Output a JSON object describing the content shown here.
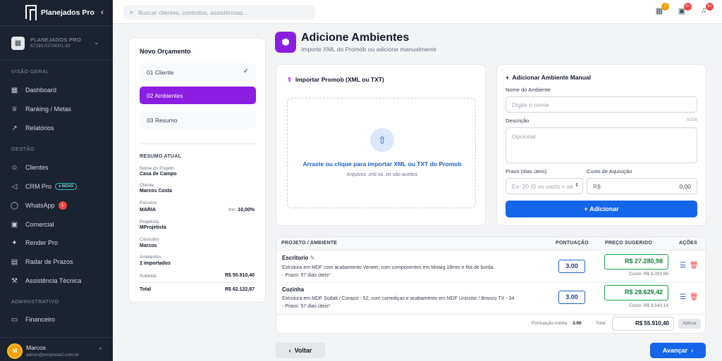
{
  "app": {
    "name": "Planejados Pro"
  },
  "company": {
    "name": "PLANEJADOS PRO",
    "cnpj": "87195.037/0001-10"
  },
  "sidebar": {
    "sections": {
      "overview": "VISÃO GERAL",
      "management": "GESTÃO",
      "admin": "ADMINISTRATIVO"
    },
    "items": [
      {
        "label": "Dashboard"
      },
      {
        "label": "Ranking / Metas"
      },
      {
        "label": "Relatórios"
      },
      {
        "label": "Clientes"
      },
      {
        "label": "CRM Pro",
        "badge": "● NOVO"
      },
      {
        "label": "WhatsApp",
        "badge": "1"
      },
      {
        "label": "Comercial"
      },
      {
        "label": "Render Pro"
      },
      {
        "label": "Radar de Prazos"
      },
      {
        "label": "Assistência Técnica"
      },
      {
        "label": "Financeiro"
      }
    ]
  },
  "user": {
    "initial": "M",
    "name": "Marcos",
    "email": "admin@empresa2.com.br"
  },
  "topbar": {
    "search_placeholder": "Buscar clientes, contratos, assistências...",
    "badges": {
      "calendar": "1",
      "tasks": "9+",
      "notifications": "9+"
    }
  },
  "steps": {
    "title": "Novo Orçamento",
    "items": [
      {
        "label": "01 Cliente"
      },
      {
        "label": "02 Ambientes"
      },
      {
        "label": "03 Resumo"
      }
    ]
  },
  "summary": {
    "title": "RESUMO ATUAL",
    "project_label": "Nome do Projeto",
    "project": "Casa de Campo",
    "client_label": "Cliente",
    "client": "Marcos Costa",
    "partner_label": "Parceiro",
    "partner": "MARIA",
    "partner_inc_label": "Inc:",
    "partner_inc": "10,00%",
    "designer_label": "Projetista",
    "designer": "MProjetista",
    "consultant_label": "Consultor",
    "consultant": "Marcos",
    "rooms_label": "Ambientes",
    "rooms": "2 importados",
    "subtotal_label": "Subtotal",
    "subtotal": "R$ 55.910,40",
    "total_label": "Total",
    "total": "R$ 62.122,67"
  },
  "header": {
    "title": "Adicione Ambientes",
    "subtitle": "Importe XML do Promob ou adicione manualmente"
  },
  "import": {
    "title": "Importar Promob (XML ou TXT)",
    "drop_main": "Arraste ou clique para importar XML ou TXT do Promob",
    "drop_sub": "Arquivos .xml ou .txt são aceitos"
  },
  "manual": {
    "title": "Adicionar Ambiente Manual",
    "name_label": "Nome do Ambiente",
    "name_placeholder": "Digite o nome",
    "desc_label": "Descrição",
    "desc_count": "0/200",
    "desc_placeholder": "Opcional",
    "term_label": "Prazo (dias úteis)",
    "term_placeholder": "Ex: 20 (0 ou vazio = se",
    "cost_label": "Custo de Aquisição",
    "cost_prefix": "R$",
    "cost_value": "0,00",
    "add_button": "Adicionar"
  },
  "table": {
    "headers": {
      "project": "PROJETO / AMBIENTE",
      "score": "PONTUAÇÃO",
      "price": "PREÇO SUGERIDO",
      "actions": "AÇÕES"
    },
    "rows": [
      {
        "name": "Escritorio",
        "description": "Estrutura em MDF com acabamento Veneer, com componentes em Mowig 18mm e fita de borda.",
        "term": "- Prazo: 57 dias úteis*",
        "score": "3.00",
        "price": "R$ 27.280,98",
        "cost": "Custo: R$ 9.093,66"
      },
      {
        "name": "Cozinha",
        "description": "Estrutura em MDF Sudati / Corazzi - 52, com corrediças e acabamento em MDF Unicolor / Branco TX - 34",
        "term": "- Prazo: 57 dias úteis*",
        "score": "3.00",
        "price": "R$ 28.629,42",
        "cost": "Custo: R$ 9.543,14"
      }
    ],
    "footer": {
      "avg_label": "Pontuação média",
      "avg": "3.00",
      "total_label": "Total",
      "total": "R$ 55.910,40",
      "apply": "Aplicar"
    }
  },
  "nav": {
    "back": "Voltar",
    "next": "Avançar"
  }
}
